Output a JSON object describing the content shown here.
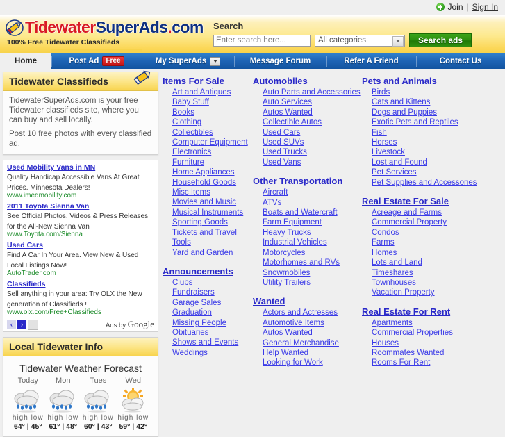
{
  "topbar": {
    "join_label": "Join",
    "separator": "|",
    "signin_label": "Sign In"
  },
  "header": {
    "logo_part1": "Tidewater",
    "logo_part2": "SuperAds",
    "logo_dot": ".",
    "logo_part3": "com",
    "tagline": "100% Free Tidewater Classifieds",
    "search_label": "Search",
    "search_placeholder": "Enter search here...",
    "search_value": "",
    "category_selected": "All categories",
    "search_button": "Search ads"
  },
  "nav": [
    {
      "label": "Home",
      "name": "nav-home"
    },
    {
      "label": "Post Ad",
      "badge": "Free",
      "name": "nav-post-ad"
    },
    {
      "label": "My SuperAds",
      "name": "nav-my-superads"
    },
    {
      "label": "Message Forum",
      "name": "nav-message-forum"
    },
    {
      "label": "Refer A Friend",
      "name": "nav-refer-a-friend"
    },
    {
      "label": "Contact Us",
      "name": "nav-contact-us"
    }
  ],
  "sidebar": {
    "classifieds_panel": {
      "title": "Tidewater Classifieds",
      "line1": "TidewaterSuperAds.com is your free Tidewater classifieds site, where you can buy and sell locally.",
      "line2": "Post 10 free photos with every classified ad."
    },
    "ads": [
      {
        "title": "Used Mobility Vans in MN",
        "desc": "Quality Handicap Accessible Vans At Great Prices. Minnesota Dealers!",
        "url": "www.imedmobility.com"
      },
      {
        "title": "2011 Toyota Sienna Van",
        "desc": "See Official Photos. Videos & Press Releases for the All-New Sienna Van",
        "url": "www.Toyota.com/Sienna"
      },
      {
        "title": "Used Cars",
        "desc": "Find A Car In Your Area. View New & Used Local Listings Now!",
        "url": "AutoTrader.com"
      },
      {
        "title": "Classifieds",
        "desc": "Sell anything in your area: Try OLX the New generation of Classifieds !",
        "url": "www.olx.com/Free+Classifieds"
      }
    ],
    "ads_prev": "‹",
    "ads_next": "›",
    "ads_by_prefix": "Ads by",
    "ads_by_brand": "Google",
    "local_panel": {
      "title": "Local Tidewater Info",
      "weather_title": "Tidewater Weather Forecast",
      "hl_label": "high  low",
      "days": [
        {
          "name": "Today",
          "icon": "rain-cloud-icon",
          "high": "64°",
          "low": "45°"
        },
        {
          "name": "Mon",
          "icon": "rain-cloud-icon",
          "high": "61°",
          "low": "48°"
        },
        {
          "name": "Tues",
          "icon": "rain-cloud-icon",
          "high": "60°",
          "low": "43°"
        },
        {
          "name": "Wed",
          "icon": "sun-cloud-icon",
          "high": "59°",
          "low": "42°"
        }
      ]
    }
  },
  "columns": [
    {
      "groups": [
        {
          "heading": "Items For Sale",
          "links": [
            "Art and Antiques",
            "Baby Stuff",
            "Books",
            "Clothing",
            "Collectibles",
            "Computer Equipment",
            "Electronics",
            "Furniture",
            "Home Appliances",
            "Household Goods",
            "Misc Items",
            "Movies and Music",
            "Musical Instruments",
            "Sporting Goods",
            "Tickets and Travel",
            "Tools",
            "Yard and Garden"
          ]
        },
        {
          "heading": "Announcements",
          "links": [
            "Clubs",
            "Fundraisers",
            "Garage Sales",
            "Graduation",
            "Missing People",
            "Obituaries",
            "Shows and Events",
            "Weddings"
          ]
        }
      ]
    },
    {
      "groups": [
        {
          "heading": "Automobiles",
          "links": [
            "Auto Parts and Accessories",
            "Auto Services",
            "Autos Wanted",
            "Collectible Autos",
            "Used Cars",
            "Used SUVs",
            "Used Trucks",
            "Used Vans"
          ]
        },
        {
          "heading": "Other Transportation",
          "links": [
            "Aircraft",
            "ATVs",
            "Boats and Watercraft",
            "Farm Equipment",
            "Heavy Trucks",
            "Industrial Vehicles",
            "Motorcycles",
            "Motorhomes and RVs",
            "Snowmobiles",
            "Utility Trailers"
          ]
        },
        {
          "heading": "Wanted",
          "links": [
            "Actors and Actresses",
            "Automotive Items",
            "Autos Wanted",
            "General Merchandise",
            "Help Wanted",
            "Looking for Work"
          ]
        }
      ]
    },
    {
      "groups": [
        {
          "heading": "Pets and Animals",
          "links": [
            "Birds",
            "Cats and Kittens",
            "Dogs and Puppies",
            "Exotic Pets and Reptiles",
            "Fish",
            "Horses",
            "Livestock",
            "Lost and Found",
            "Pet Services",
            "Pet Supplies and Accessories"
          ]
        },
        {
          "heading": "Real Estate For Sale",
          "links": [
            "Acreage and Farms",
            "Commercial Property",
            "Condos",
            "Farms",
            "Homes",
            "Lots and Land",
            "Timeshares",
            "Townhouses",
            "Vacation Property"
          ]
        },
        {
          "heading": "Real Estate For Rent",
          "links": [
            "Apartments",
            "Commercial Properties",
            "Houses",
            "Roommates Wanted",
            "Rooms For Rent"
          ]
        }
      ]
    }
  ]
}
